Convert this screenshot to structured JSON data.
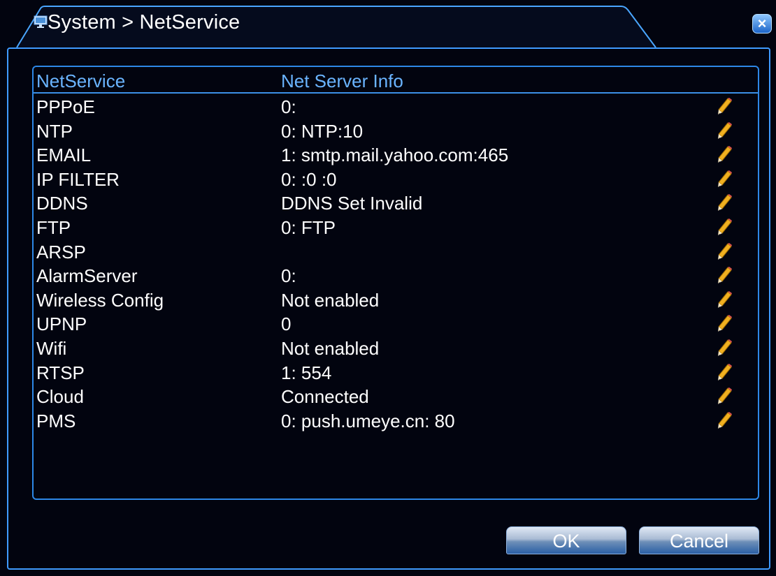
{
  "window": {
    "title": "System > NetService",
    "close_label": "×"
  },
  "table": {
    "headers": [
      "NetService",
      "Net Server Info"
    ],
    "rows": [
      {
        "name": "PPPoE",
        "info": "0:"
      },
      {
        "name": "NTP",
        "info": "0: NTP:10"
      },
      {
        "name": "EMAIL",
        "info": "1: smtp.mail.yahoo.com:465"
      },
      {
        "name": "IP FILTER",
        "info": "0: :0 :0"
      },
      {
        "name": "DDNS",
        "info": "DDNS Set Invalid"
      },
      {
        "name": "FTP",
        "info": "0: FTP"
      },
      {
        "name": "ARSP",
        "info": ""
      },
      {
        "name": "AlarmServer",
        "info": "0:"
      },
      {
        "name": "Wireless Config",
        "info": "Not enabled"
      },
      {
        "name": "UPNP",
        "info": "0"
      },
      {
        "name": "Wifi",
        "info": "Not enabled"
      },
      {
        "name": "RTSP",
        "info": "1: 554"
      },
      {
        "name": "Cloud",
        "info": "Connected"
      },
      {
        "name": "PMS",
        "info": "0: push.umeye.cn: 80"
      }
    ],
    "edit_icon": "pencil-icon"
  },
  "buttons": {
    "ok_label": "OK",
    "cancel_label": "Cancel"
  },
  "colors": {
    "accent": "#3f9bff",
    "header_text": "#6ab4ff",
    "background": "#02040f",
    "pencil": "#f0b020"
  }
}
